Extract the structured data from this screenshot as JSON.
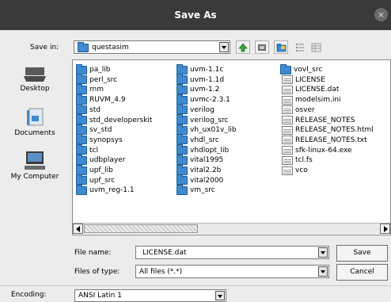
{
  "window": {
    "title": "Save As",
    "close_glyph": "×"
  },
  "toolbar": {
    "save_in_label": "Save in:",
    "save_in_value": "questasim",
    "icons": [
      "up-folder-icon",
      "home-icon",
      "new-folder-icon",
      "list-view-icon",
      "details-view-icon"
    ]
  },
  "places": [
    {
      "label": "Desktop",
      "icon": "desktop-icon"
    },
    {
      "label": "Documents",
      "icon": "documents-icon"
    },
    {
      "label": "My Computer",
      "icon": "computer-icon"
    }
  ],
  "files": {
    "col1": [
      "pa_lib",
      "perl_src",
      "rnm",
      "RUVM_4.9",
      "std",
      "std_developerskit",
      "sv_std",
      "synopsys",
      "tcl",
      "udbplayer",
      "upf_lib",
      "upf_src",
      "uvm_reg-1.1"
    ],
    "col2": [
      "uvm-1.1c",
      "uvm-1.1d",
      "uvm-1.2",
      "uvmc-2.3.1",
      "verilog",
      "verilog_src",
      "vh_ux01v_lib",
      "vhdl_src",
      "vhdlopt_lib",
      "vital1995",
      "vital2.2b",
      "vital2000",
      "vm_src"
    ],
    "col3_folders": [
      "vovl_src"
    ],
    "col3_files": [
      "LICENSE",
      "LICENSE.dat",
      "modelsim.ini",
      "osver",
      "RELEASE_NOTES",
      "RELEASE_NOTES.html",
      "RELEASE_NOTES.txt",
      "sfk-linux-64.exe",
      "tcl.fs",
      "vco"
    ]
  },
  "form": {
    "file_name_label": "File name:",
    "file_name_value": "LICENSE.dat",
    "file_type_label": "Files of type:",
    "file_type_value": "All files (*.*)",
    "save_button": "Save",
    "cancel_button": "Cancel",
    "encoding_label": "Encoding:",
    "encoding_value": "ANSI Latin 1"
  },
  "colors": {
    "titlebar": "#3a3a3a",
    "folder": "#3e89d0",
    "dialog_bg": "#ececec"
  }
}
